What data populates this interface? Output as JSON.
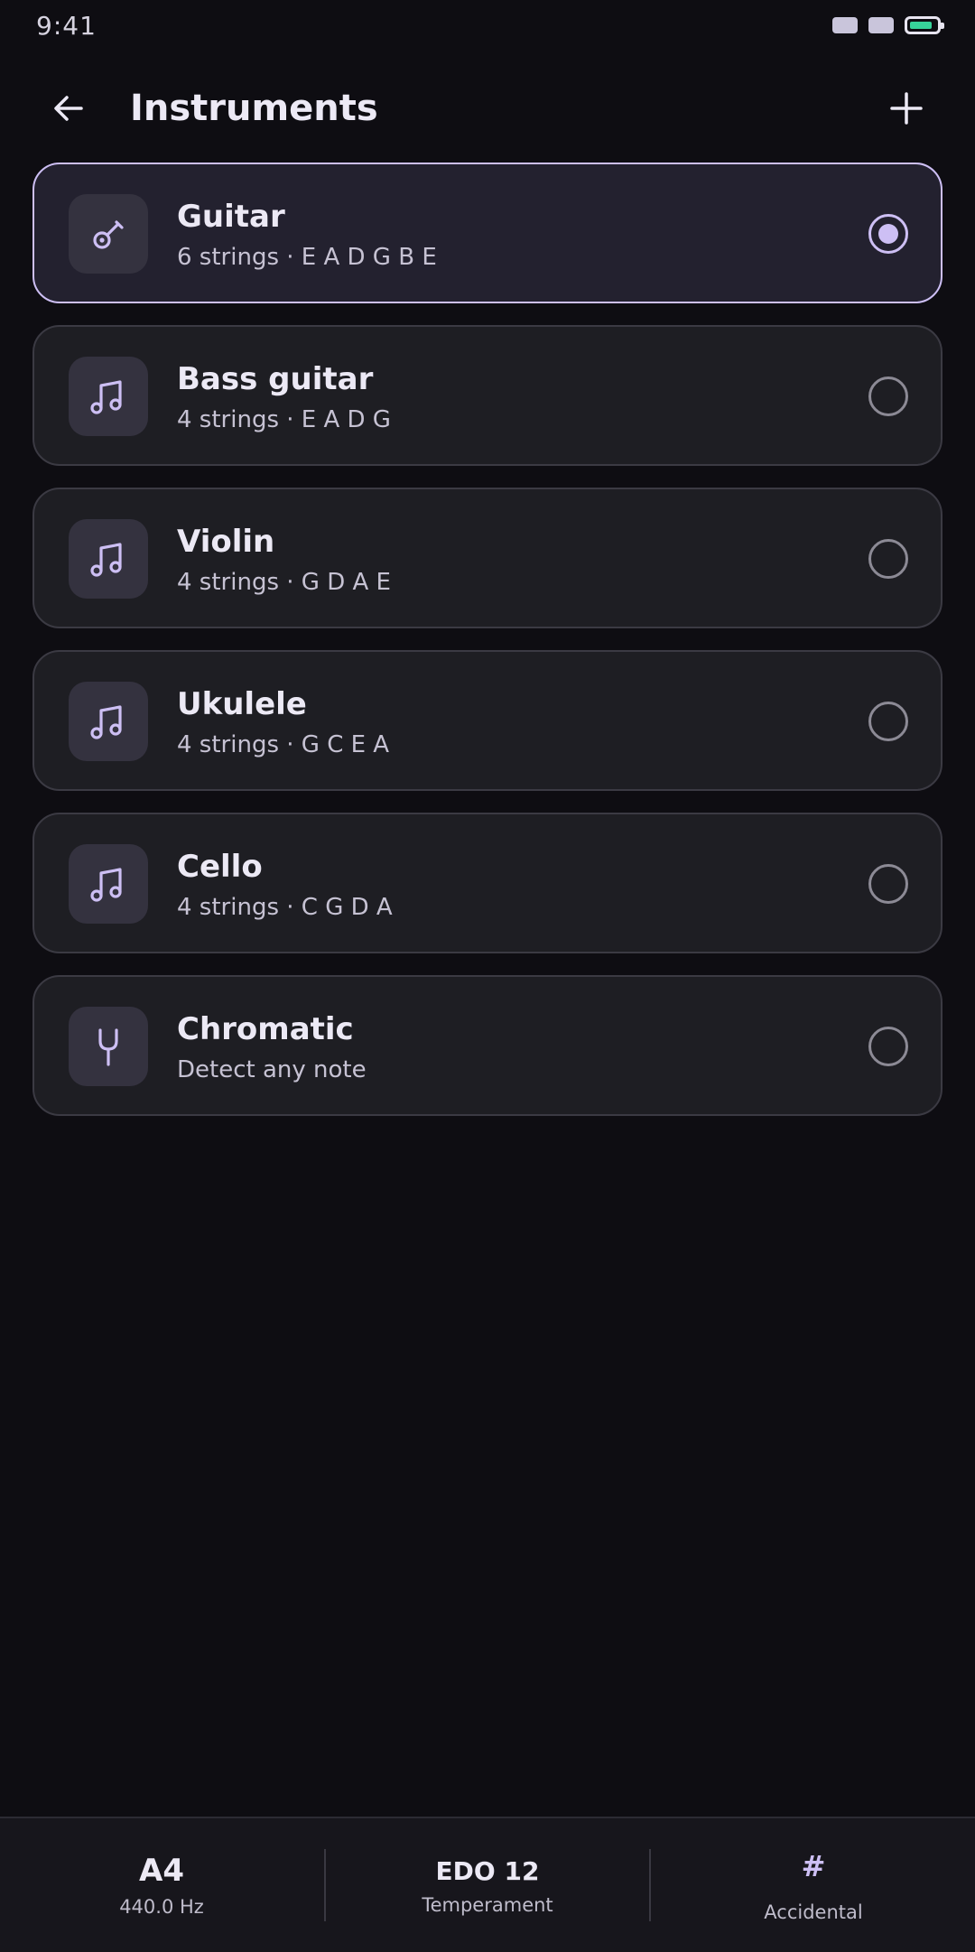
{
  "status_bar": {
    "time": "9:41"
  },
  "header": {
    "title": "Instruments"
  },
  "instruments": [
    {
      "name": "Guitar",
      "detail": "6 strings · E A D G B E",
      "icon": "guitar-icon",
      "selected": true
    },
    {
      "name": "Bass guitar",
      "detail": "4 strings · E A D G",
      "icon": "music-note-icon",
      "selected": false
    },
    {
      "name": "Violin",
      "detail": "4 strings · G D A E",
      "icon": "music-note-icon",
      "selected": false
    },
    {
      "name": "Ukulele",
      "detail": "4 strings · G C E A",
      "icon": "music-note-icon",
      "selected": false
    },
    {
      "name": "Cello",
      "detail": "4 strings · C G D A",
      "icon": "music-note-icon",
      "selected": false
    },
    {
      "name": "Chromatic",
      "detail": "Detect any note",
      "icon": "tuning-fork-icon",
      "selected": false
    }
  ],
  "bottom_bar": {
    "reference": {
      "value": "A4",
      "label": "440.0 Hz"
    },
    "temperament": {
      "value": "EDO 12",
      "label": "Temperament"
    },
    "accidental": {
      "symbol": "#",
      "label": "Accidental"
    }
  },
  "colors": {
    "background": "#0e0d12",
    "card": "#1e1e23",
    "accent": "#cdbff4",
    "battery": "#37d39a"
  }
}
